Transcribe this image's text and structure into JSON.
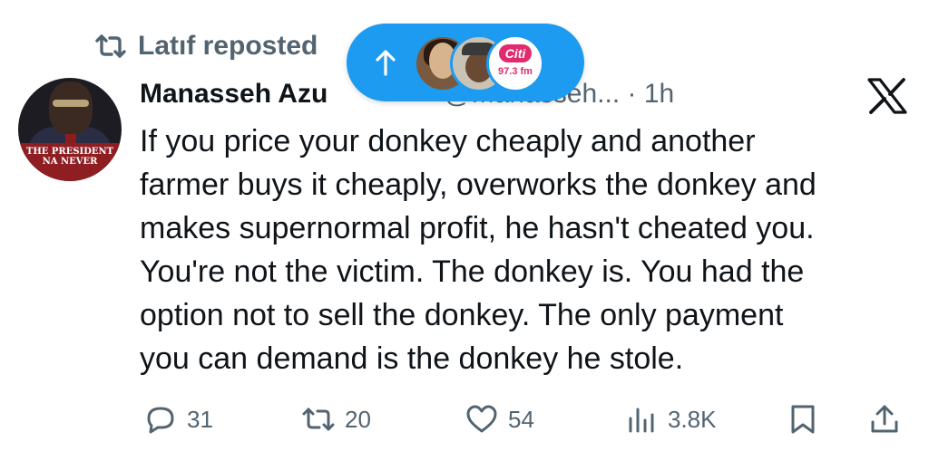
{
  "repost": {
    "label": "Latıf reposted",
    "icon": "repost-icon"
  },
  "new_posts_pill": {
    "icon": "arrow-up-icon",
    "avatars": [
      "user-avatar-1",
      "user-avatar-2",
      "citi-fm-avatar"
    ],
    "citi_logo_text": "Citi",
    "citi_frequency": "97.3 fm"
  },
  "author": {
    "name": "Manasseh Azu",
    "handle": "@Manasseh...",
    "separator": "·",
    "time": "1h",
    "avatar_caption": "THE PRESIDENT NA NEVER"
  },
  "tweet": {
    "lines": [
      "If you price your donkey cheaply and another",
      "farmer buys it cheaply, overworks the donkey and",
      "makes supernormal profit, he hasn't cheated you.",
      "You're not the victim. The donkey is. You had the",
      "option not to sell the donkey. The only payment",
      "you can demand is the donkey he stole."
    ]
  },
  "actions": {
    "replies": "31",
    "reposts": "20",
    "likes": "54",
    "views": "3.8K"
  },
  "colors": {
    "accent": "#1d9bf0",
    "text": "#0f1419",
    "muted": "#536471",
    "citi": "#e02b6f"
  }
}
